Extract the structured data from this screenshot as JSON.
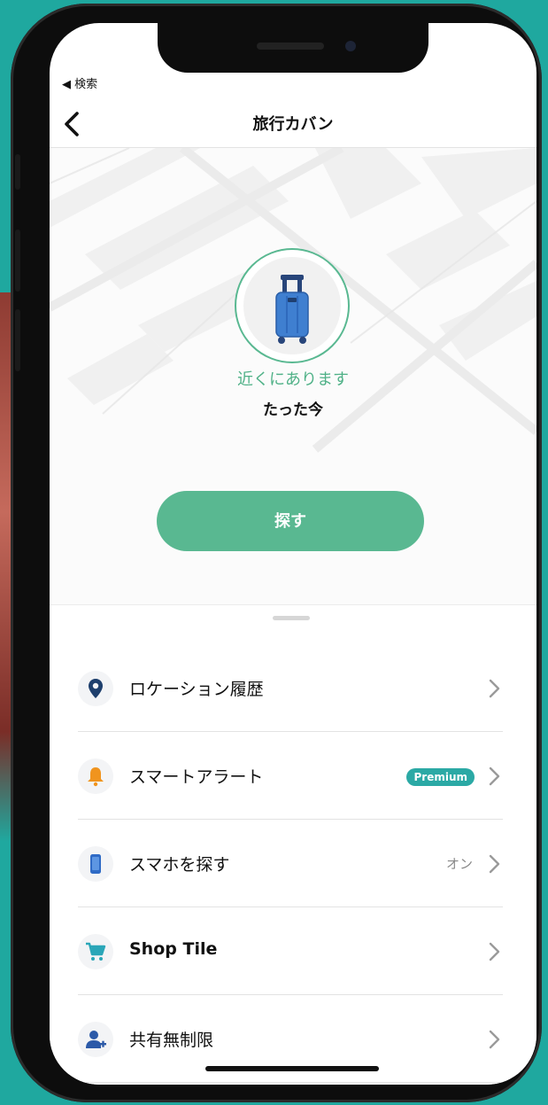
{
  "status_bar": {
    "back_label": "◀ 検索"
  },
  "nav": {
    "title": "旅行カバン",
    "back_icon": "chevron-left-icon"
  },
  "device": {
    "icon": "suitcase-icon",
    "status": "近くにあります",
    "time": "たった今",
    "accent": "#59b891"
  },
  "find_button": {
    "label": "探す"
  },
  "menu": {
    "items": [
      {
        "label": "ロケーション履歴",
        "icon": "location-pin-icon"
      },
      {
        "label": "スマートアラート",
        "icon": "bell-icon",
        "badge": "Premium"
      },
      {
        "label": "スマホを探す",
        "icon": "phone-icon",
        "value": "オン"
      },
      {
        "label": "Shop Tile",
        "icon": "cart-icon"
      },
      {
        "label": "共有無制限",
        "icon": "user-add-icon"
      }
    ]
  },
  "colors": {
    "accent_green": "#59b891",
    "badge_teal": "#2ba9a5",
    "background": "#1fa89f"
  }
}
